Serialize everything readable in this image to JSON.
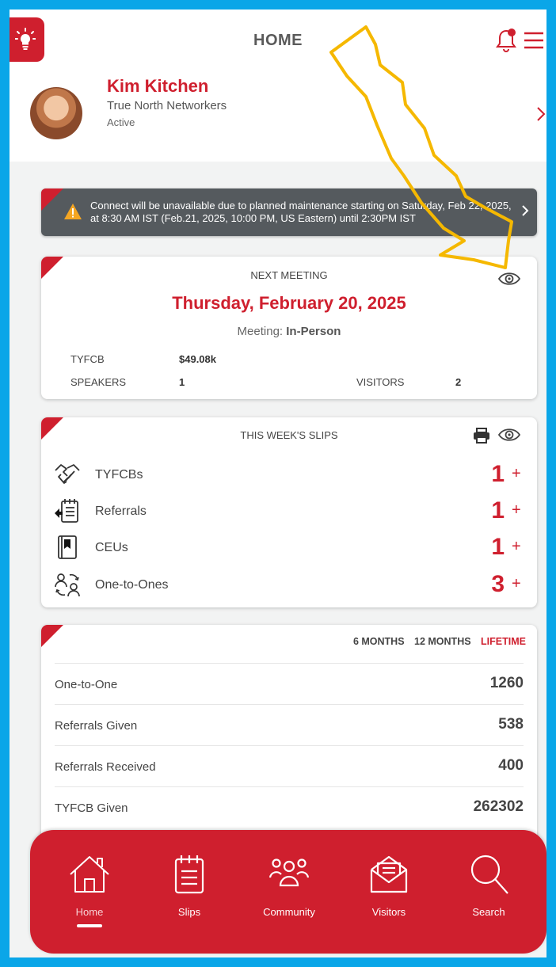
{
  "header": {
    "title": "HOME",
    "icons": {
      "left": "lightbulb-icon",
      "notification": "bell-icon",
      "menu": "hamburger-icon"
    }
  },
  "profile": {
    "name": "Kim Kitchen",
    "organization": "True North Networkers",
    "status": "Active"
  },
  "banner": {
    "message": "Connect will be unavailable due to planned maintenance starting on Saturday, Feb 22, 2025, at 8:30 AM IST (Feb.21, 2025, 10:00 PM, US Eastern) until 2:30PM IST"
  },
  "next_meeting": {
    "label": "NEXT MEETING",
    "date": "Thursday, February 20, 2025",
    "type_label": "Meeting: ",
    "type_value": "In-Person",
    "tyfcb_label": "TYFCB",
    "tyfcb_value": "$49.08k",
    "speakers_label": "SPEAKERS",
    "speakers_value": "1",
    "visitors_label": "VISITORS",
    "visitors_value": "2"
  },
  "slips": {
    "label": "THIS WEEK'S SLIPS",
    "items": [
      {
        "label": "TYFCBs",
        "count": "1",
        "icon": "handshake-icon"
      },
      {
        "label": "Referrals",
        "count": "1",
        "icon": "referral-list-icon"
      },
      {
        "label": "CEUs",
        "count": "1",
        "icon": "book-icon"
      },
      {
        "label": "One-to-Ones",
        "count": "3",
        "icon": "people-exchange-icon"
      }
    ],
    "add_symbol": "+"
  },
  "stats": {
    "filters": [
      "6 MONTHS",
      "12 MONTHS",
      "LIFETIME"
    ],
    "active_filter": "LIFETIME",
    "rows": [
      {
        "label": "One-to-One",
        "value": "1260"
      },
      {
        "label": "Referrals Given",
        "value": "538"
      },
      {
        "label": "Referrals Received",
        "value": "400"
      },
      {
        "label": "TYFCB Given",
        "value": "262302"
      }
    ]
  },
  "bottom_nav": [
    {
      "label": "Home",
      "icon": "home-icon"
    },
    {
      "label": "Slips",
      "icon": "notepad-icon"
    },
    {
      "label": "Community",
      "icon": "community-icon"
    },
    {
      "label": "Visitors",
      "icon": "mail-icon"
    },
    {
      "label": "Search",
      "icon": "search-icon"
    }
  ],
  "colors": {
    "brand_red": "#cf1f2e",
    "banner_gray": "#555a5e",
    "frame_blue": "#0aa6e8",
    "annotation_yellow": "#f5b800"
  }
}
